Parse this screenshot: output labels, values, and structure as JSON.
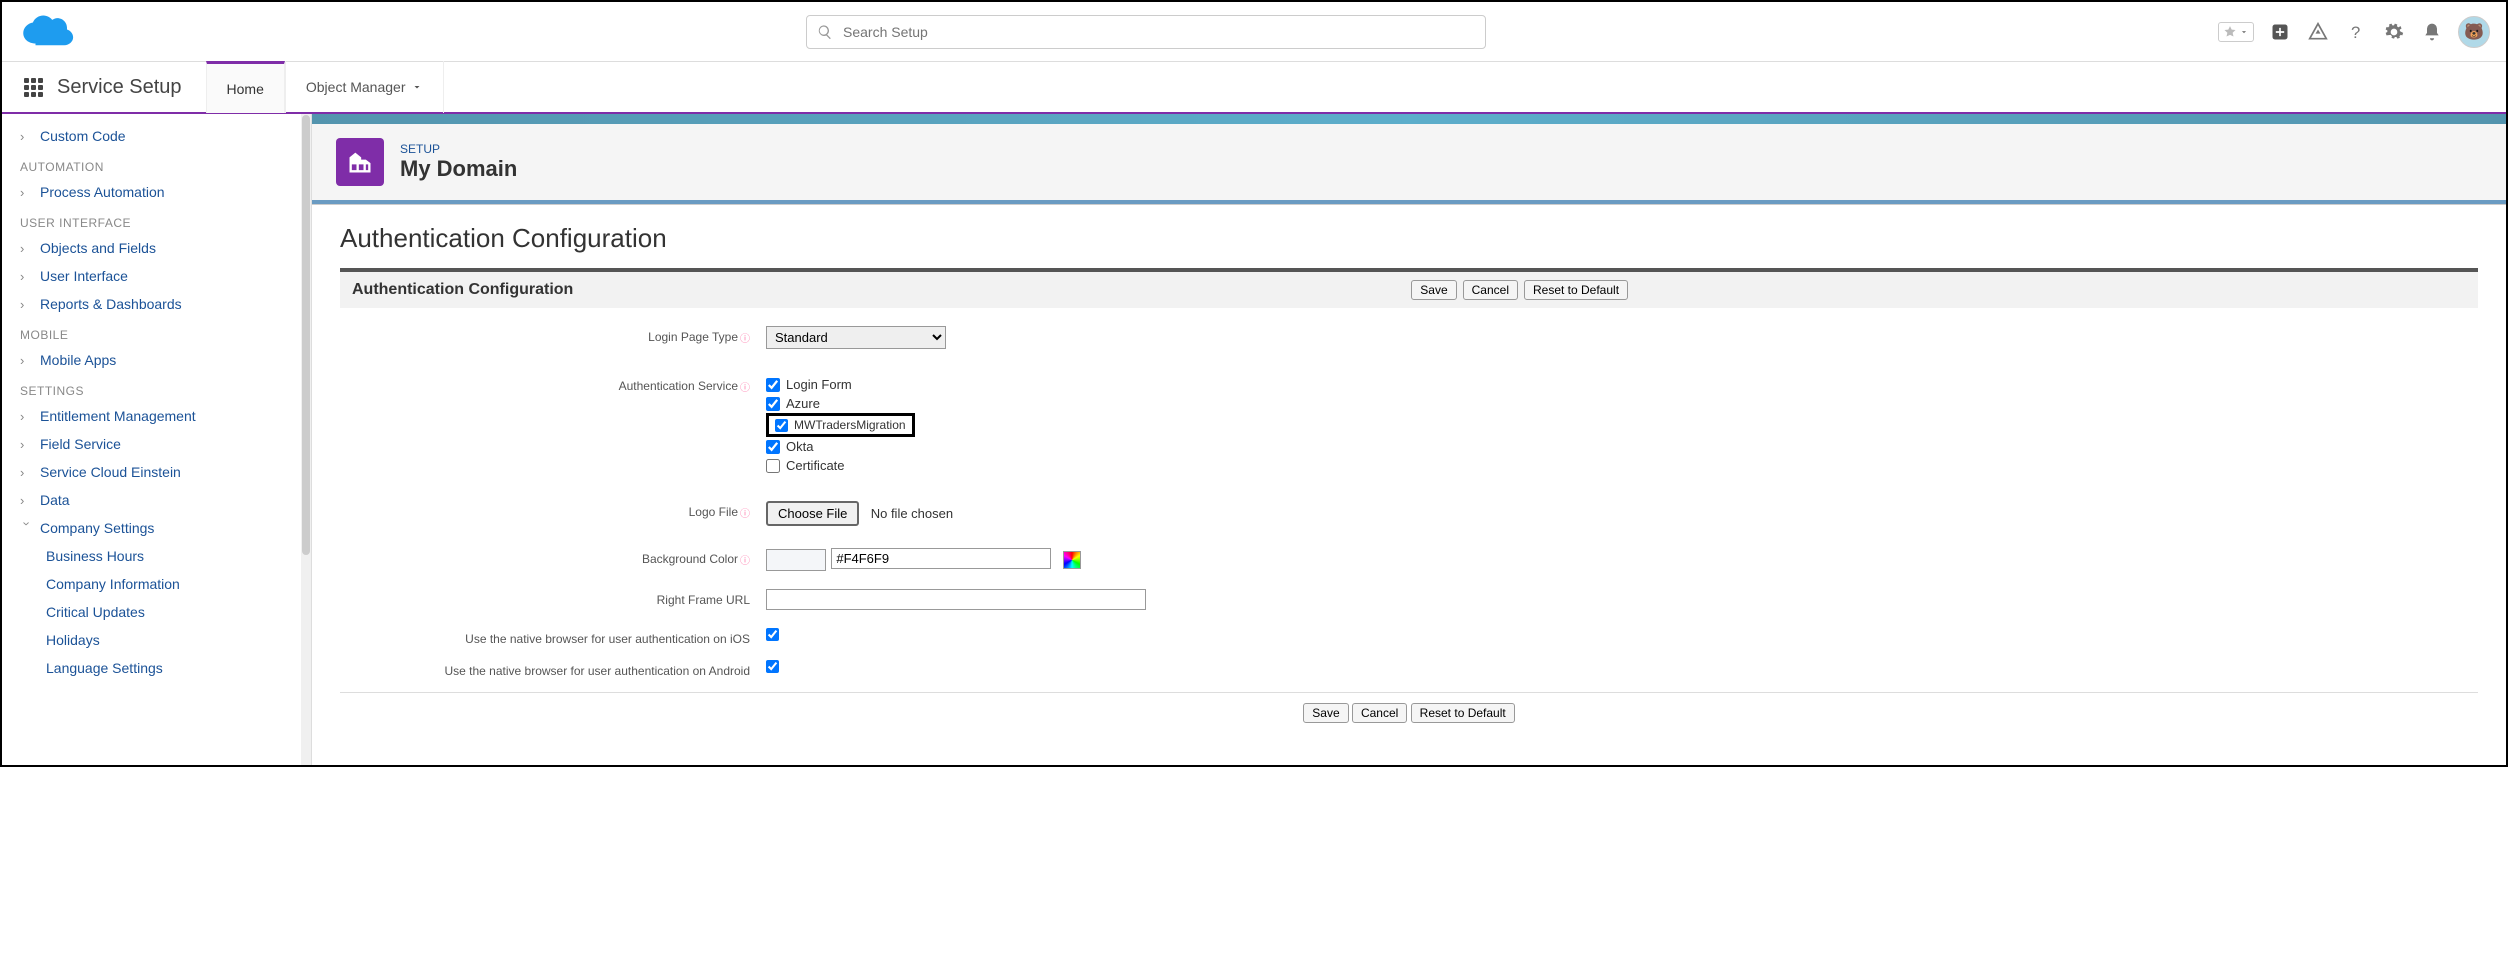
{
  "search": {
    "placeholder": "Search Setup"
  },
  "nav": {
    "title": "Service Setup",
    "tabs": [
      "Home",
      "Object Manager"
    ]
  },
  "sidebar": {
    "items": [
      {
        "label": "Custom Code",
        "type": "item"
      },
      {
        "label": "AUTOMATION",
        "type": "head"
      },
      {
        "label": "Process Automation",
        "type": "item"
      },
      {
        "label": "USER INTERFACE",
        "type": "head"
      },
      {
        "label": "Objects and Fields",
        "type": "item"
      },
      {
        "label": "User Interface",
        "type": "item"
      },
      {
        "label": "Reports & Dashboards",
        "type": "item"
      },
      {
        "label": "MOBILE",
        "type": "head"
      },
      {
        "label": "Mobile Apps",
        "type": "item"
      },
      {
        "label": "SETTINGS",
        "type": "head"
      },
      {
        "label": "Entitlement Management",
        "type": "item"
      },
      {
        "label": "Field Service",
        "type": "item"
      },
      {
        "label": "Service Cloud Einstein",
        "type": "item"
      },
      {
        "label": "Data",
        "type": "item"
      },
      {
        "label": "Company Settings",
        "type": "item",
        "open": true,
        "children": [
          "Business Hours",
          "Company Information",
          "Critical Updates",
          "Holidays",
          "Language Settings"
        ]
      }
    ]
  },
  "page": {
    "crumb": "SETUP",
    "title": "My Domain"
  },
  "section": {
    "heading": "Authentication Configuration",
    "bartitle": "Authentication Configuration",
    "buttons": {
      "save": "Save",
      "cancel": "Cancel",
      "reset": "Reset to Default"
    },
    "labels": {
      "login_page_type": "Login Page Type",
      "auth_service": "Authentication Service",
      "logo_file": "Logo File",
      "bg_color": "Background Color",
      "right_frame": "Right Frame URL",
      "native_ios": "Use the native browser for user authentication on iOS",
      "native_android": "Use the native browser for user authentication on Android"
    },
    "login_page_type_value": "Standard",
    "auth_services": [
      {
        "label": "Login Form",
        "checked": true
      },
      {
        "label": "Azure",
        "checked": true
      },
      {
        "label": "MWTradersMigration",
        "checked": true,
        "highlight": true
      },
      {
        "label": "Okta",
        "checked": true
      },
      {
        "label": "Certificate",
        "checked": false
      }
    ],
    "logo": {
      "btn": "Choose File",
      "status": "No file chosen"
    },
    "bg_color_value": "#F4F6F9",
    "right_frame_value": "",
    "native_ios_checked": true,
    "native_android_checked": true
  }
}
